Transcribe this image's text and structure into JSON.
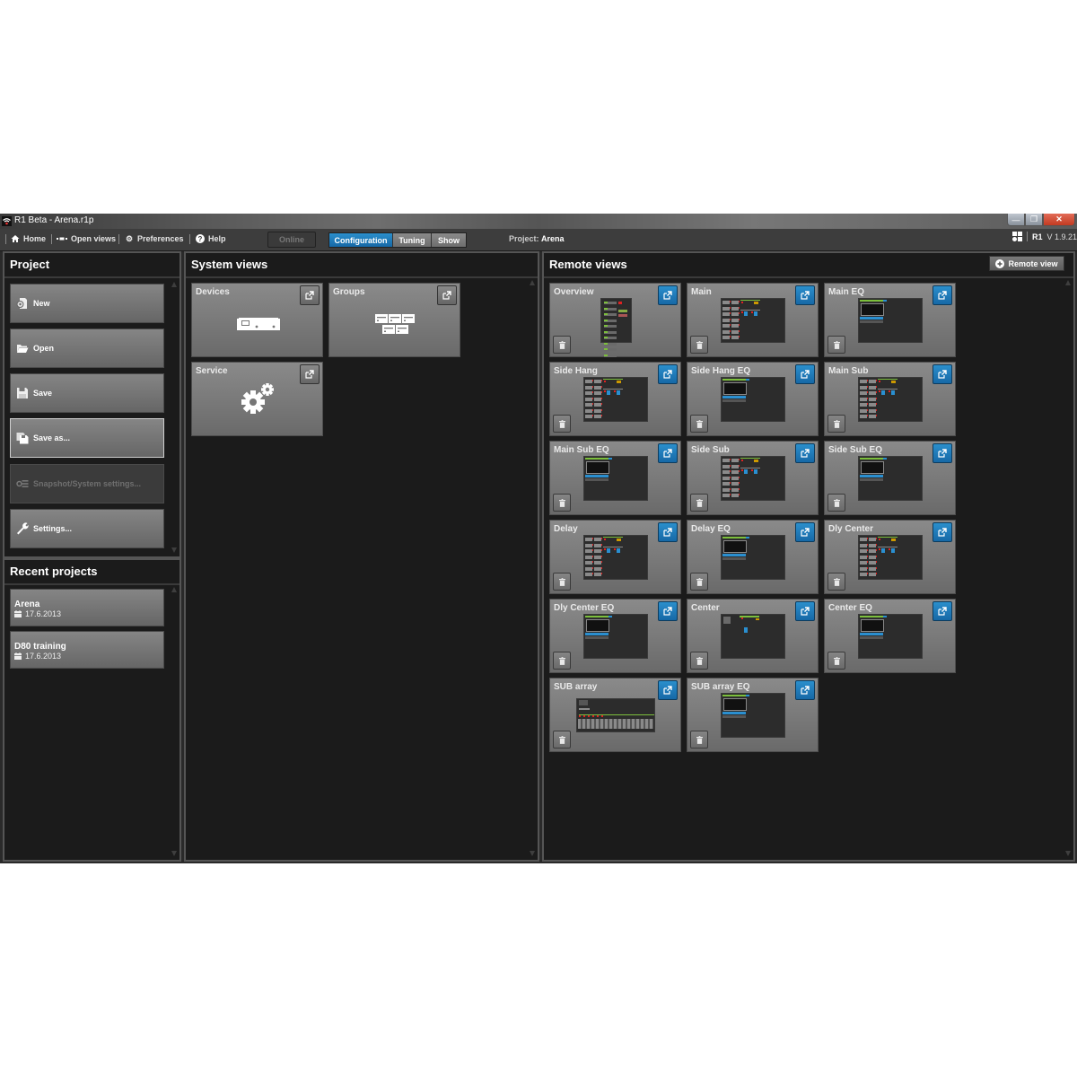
{
  "window": {
    "title": "R1 Beta - Arena.r1p",
    "app_icon": "wifi-signal-icon",
    "controls": [
      "minimize",
      "restore",
      "close"
    ]
  },
  "toolbar": {
    "items": [
      {
        "label": "Home",
        "icon": "home-icon"
      },
      {
        "label": "Open views",
        "icon": "open-views-icon"
      },
      {
        "label": "Preferences",
        "icon": "gear-icon"
      },
      {
        "label": "Help",
        "icon": "help-icon"
      }
    ],
    "online_label": "Online",
    "modes": [
      {
        "label": "Configuration",
        "active": true
      },
      {
        "label": "Tuning",
        "active": false
      },
      {
        "label": "Show",
        "active": false
      }
    ],
    "project_prefix": "Project:",
    "project_name": "Arena",
    "brand": "R1",
    "version": "V 1.9.21"
  },
  "project_panel": {
    "title": "Project",
    "buttons": [
      {
        "label": "New",
        "icon": "new-project-icon",
        "state": "normal"
      },
      {
        "label": "Open",
        "icon": "folder-open-icon",
        "state": "normal"
      },
      {
        "label": "Save",
        "icon": "save-icon",
        "state": "normal"
      },
      {
        "label": "Save as...",
        "icon": "save-as-icon",
        "state": "selected"
      },
      {
        "label": "Snapshot/System settings...",
        "icon": "snapshot-settings-icon",
        "state": "disabled"
      },
      {
        "label": "Settings...",
        "icon": "wrench-icon",
        "state": "normal"
      }
    ]
  },
  "recent_panel": {
    "title": "Recent projects",
    "items": [
      {
        "name": "Arena",
        "date": "17.6.2013"
      },
      {
        "name": "D80 training",
        "date": "17.6.2013"
      }
    ]
  },
  "system_views": {
    "title": "System views",
    "tiles": [
      {
        "name": "Devices",
        "icon": "device-rack-icon"
      },
      {
        "name": "Groups",
        "icon": "groups-icon"
      },
      {
        "name": "Service",
        "icon": "gears-icon"
      }
    ]
  },
  "remote_views": {
    "title": "Remote views",
    "add_button_label": "Remote view",
    "accent": "#1a78b8",
    "tiles": [
      {
        "name": "Overview",
        "thumb": "overview"
      },
      {
        "name": "Main",
        "thumb": "matrix"
      },
      {
        "name": "Main EQ",
        "thumb": "eq"
      },
      {
        "name": "Side Hang",
        "thumb": "matrix"
      },
      {
        "name": "Side Hang EQ",
        "thumb": "eq"
      },
      {
        "name": "Main Sub",
        "thumb": "matrix"
      },
      {
        "name": "Main Sub EQ",
        "thumb": "eq"
      },
      {
        "name": "Side Sub",
        "thumb": "matrix"
      },
      {
        "name": "Side Sub EQ",
        "thumb": "eq"
      },
      {
        "name": "Delay",
        "thumb": "matrix"
      },
      {
        "name": "Delay EQ",
        "thumb": "eq"
      },
      {
        "name": "Dly Center",
        "thumb": "matrix"
      },
      {
        "name": "Dly Center EQ",
        "thumb": "eq"
      },
      {
        "name": "Center",
        "thumb": "center"
      },
      {
        "name": "Center EQ",
        "thumb": "eq"
      },
      {
        "name": "SUB array",
        "thumb": "subarray"
      },
      {
        "name": "SUB array EQ",
        "thumb": "eq"
      }
    ]
  }
}
